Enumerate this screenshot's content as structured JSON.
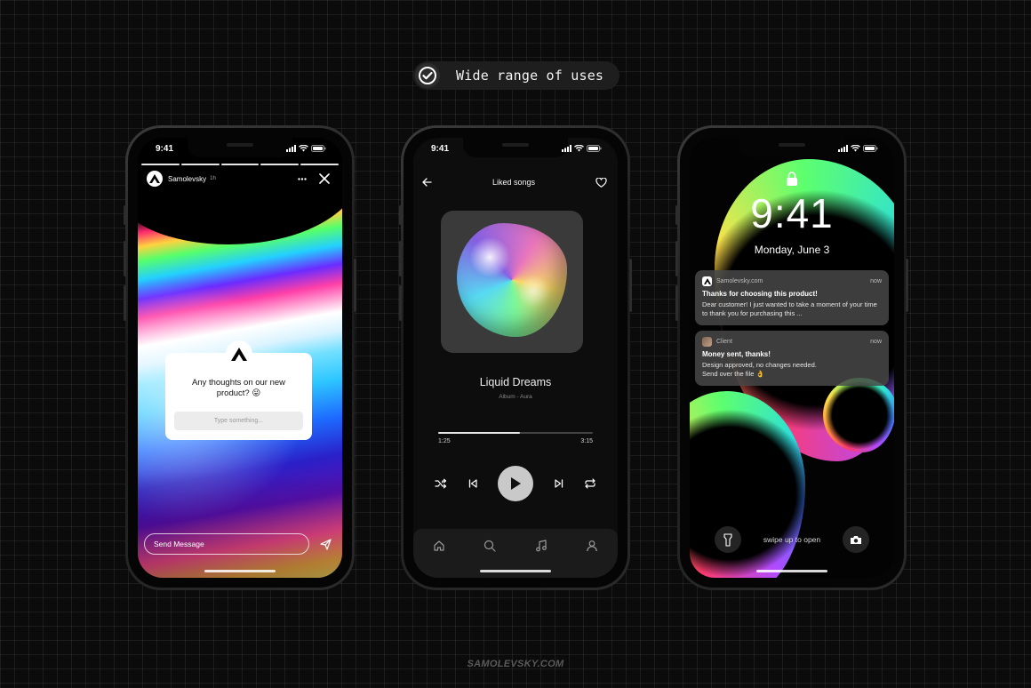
{
  "headline": {
    "text": "Wide range of uses",
    "icon": "check-circle-icon"
  },
  "footer": {
    "brand": "SAMOLEVSKY.COM"
  },
  "colors": {
    "background": "#0b0b0b",
    "card": "#ffffff",
    "accent_gray": "#c9c9c9"
  },
  "phones": {
    "story": {
      "status_time": "9:41",
      "username": "Samolevsky",
      "posted_ago": "1h",
      "question": "Any thoughts on our new product? 😜",
      "answer_placeholder": "Type something...",
      "message_placeholder": "Send Message"
    },
    "music": {
      "status_time": "9:41",
      "header_title": "Liked songs",
      "song_title": "Liquid Dreams",
      "song_subtitle": "Album - Aura",
      "elapsed": "1:25",
      "duration": "3:15",
      "progress": 0.53,
      "tabs": [
        "home-icon",
        "search-icon",
        "music-note-icon",
        "profile-icon"
      ]
    },
    "lock": {
      "status_time": "",
      "time": "9:41",
      "date": "Monday, June 3",
      "notifications": [
        {
          "app": "Samolevsky.com",
          "time": "now",
          "title": "Thanks for choosing this product!",
          "body": "Dear customer! I just wanted to take a moment of your time to thank you for purchasing this ..."
        },
        {
          "app": "Client",
          "time": "now",
          "title": "Money sent, thanks!",
          "body_line1": "Design approved, no changes needed.",
          "body_line2": "Send over the file 👌"
        }
      ],
      "swipe_hint": "swipe up to open"
    }
  }
}
